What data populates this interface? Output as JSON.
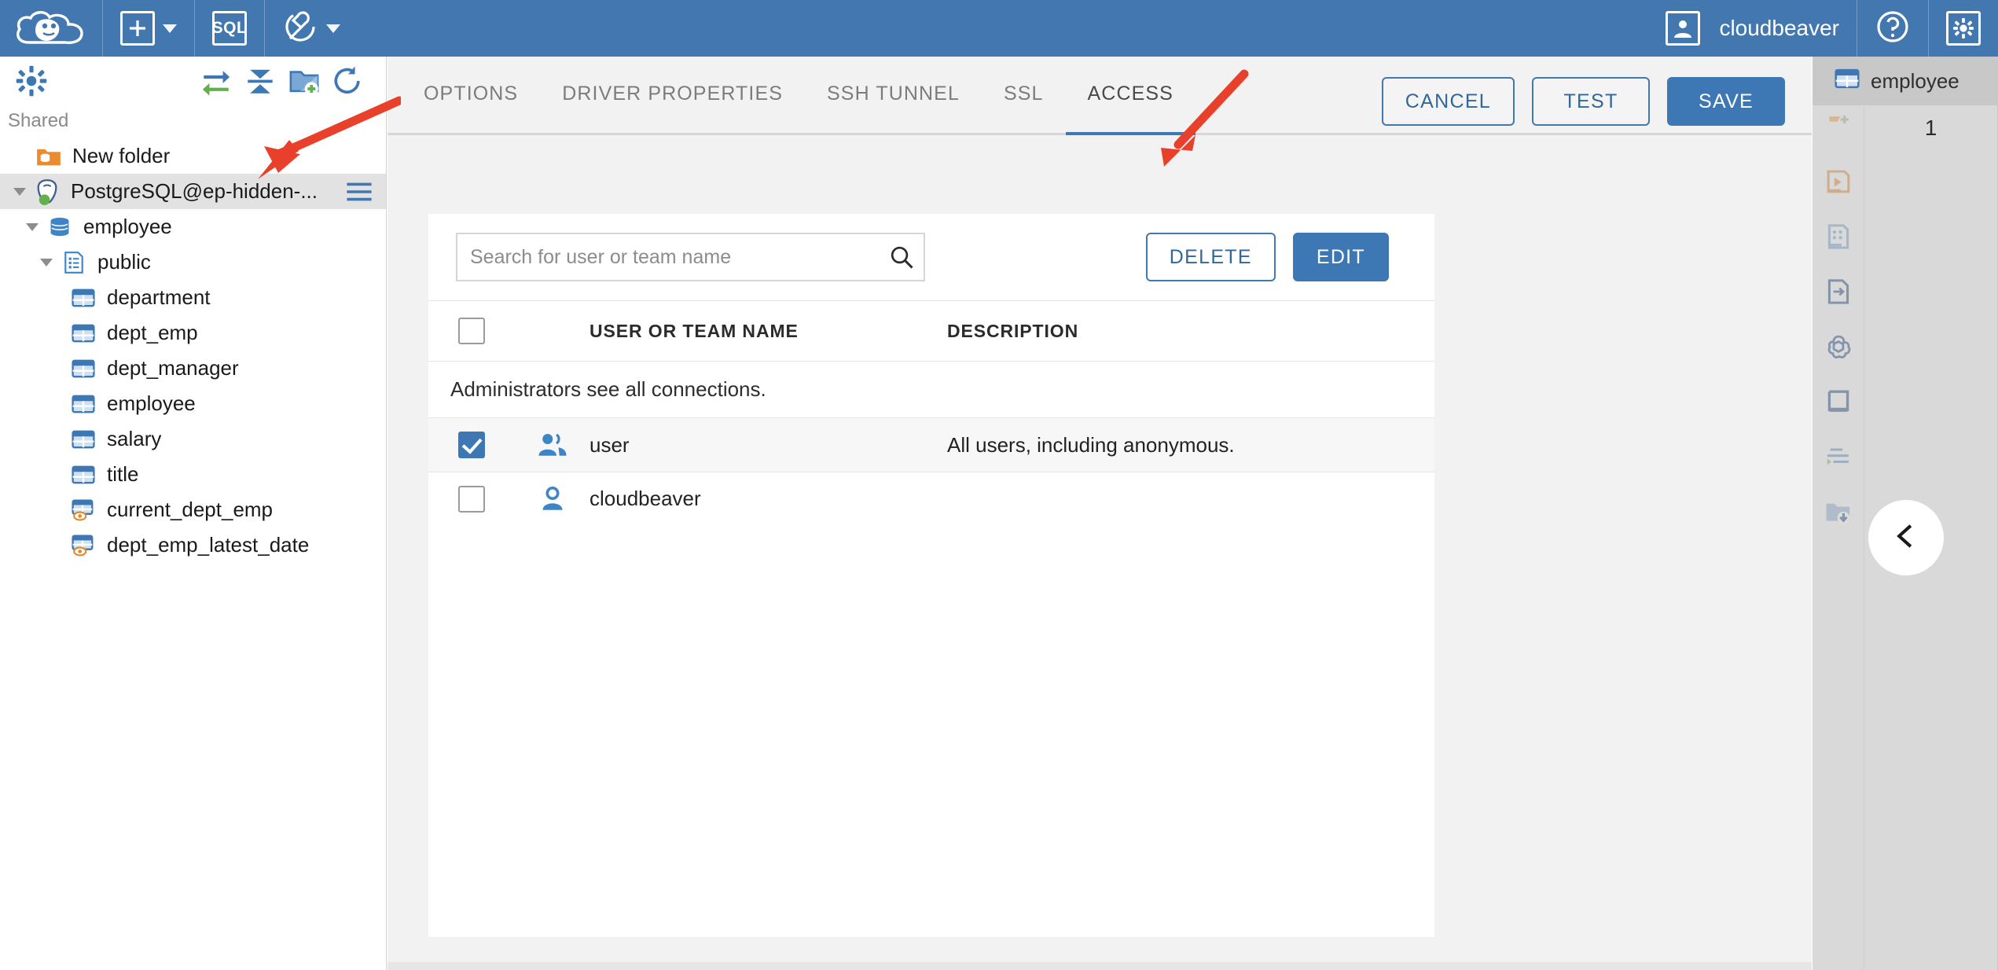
{
  "header": {
    "logo_icon": "cloudbeaver-logo-icon",
    "new_connection_label": "+",
    "new_connection_icon": "plus-box-icon",
    "new_connection_chevron": "chevron-down-icon",
    "sql_label": "SQL",
    "sql_icon": "sql-box-icon",
    "tools_icon": "wrench-circle-icon",
    "tools_chevron": "chevron-down-icon",
    "user_name": "cloudbeaver",
    "user_icon": "user-avatar-icon",
    "help_icon": "question-circle-icon",
    "settings_icon": "gear-box-icon",
    "accent_color": "#4277b0"
  },
  "sidebar": {
    "settings_icon": "gear-icon",
    "toolbar": [
      {
        "name": "sync-connections-icon",
        "title": "Sync"
      },
      {
        "name": "collapse-all-icon",
        "title": "Collapse all"
      },
      {
        "name": "add-folder-icon",
        "title": "Add folder"
      },
      {
        "name": "refresh-icon",
        "title": "Refresh"
      }
    ],
    "shared_label": "Shared",
    "tree": [
      {
        "label": "New folder",
        "icon": "folder-database-icon",
        "indent": 1,
        "expandable": false,
        "selected": false
      },
      {
        "label": "PostgreSQL@ep-hidden-...",
        "icon": "postgresql-connected-icon",
        "indent": 0,
        "expandable": true,
        "selected": true,
        "menu_icon": "hamburger-menu-icon"
      },
      {
        "label": "employee",
        "icon": "database-icon",
        "indent": 1,
        "expandable": true,
        "selected": false
      },
      {
        "label": "public",
        "icon": "schema-icon",
        "indent": 2,
        "expandable": true,
        "selected": false
      },
      {
        "label": "department",
        "icon": "table-icon",
        "indent": 4,
        "expandable": false,
        "selected": false
      },
      {
        "label": "dept_emp",
        "icon": "table-icon",
        "indent": 4,
        "expandable": false,
        "selected": false
      },
      {
        "label": "dept_manager",
        "icon": "table-icon",
        "indent": 4,
        "expandable": false,
        "selected": false
      },
      {
        "label": "employee",
        "icon": "table-icon",
        "indent": 4,
        "expandable": false,
        "selected": false
      },
      {
        "label": "salary",
        "icon": "table-icon",
        "indent": 4,
        "expandable": false,
        "selected": false
      },
      {
        "label": "title",
        "icon": "table-icon",
        "indent": 4,
        "expandable": false,
        "selected": false
      },
      {
        "label": "current_dept_emp",
        "icon": "view-icon",
        "indent": 4,
        "expandable": false,
        "selected": false
      },
      {
        "label": "dept_emp_latest_date",
        "icon": "view-icon",
        "indent": 4,
        "expandable": false,
        "selected": false
      }
    ]
  },
  "main": {
    "tabs": [
      {
        "label": "OPTIONS",
        "active": false
      },
      {
        "label": "DRIVER PROPERTIES",
        "active": false
      },
      {
        "label": "SSH TUNNEL",
        "active": false
      },
      {
        "label": "SSL",
        "active": false
      },
      {
        "label": "ACCESS",
        "active": true
      }
    ],
    "actions": {
      "cancel_label": "CANCEL",
      "test_label": "TEST",
      "save_label": "SAVE"
    },
    "access": {
      "search_placeholder": "Search for user or team name",
      "search_value": "",
      "search_icon": "search-icon",
      "delete_label": "DELETE",
      "edit_label": "EDIT",
      "columns": [
        "",
        "",
        "USER OR TEAM NAME",
        "DESCRIPTION"
      ],
      "note": "Administrators see all connections.",
      "header_checkbox_checked": false,
      "rows": [
        {
          "checked": true,
          "icon": "team-group-icon",
          "name": "user",
          "description": "All users, including anonymous."
        },
        {
          "checked": false,
          "icon": "single-user-icon",
          "name": "cloudbeaver",
          "description": ""
        }
      ]
    }
  },
  "right_panel": {
    "tab_label": "employee",
    "tab_icon": "table-icon",
    "cell_value": "1",
    "collapse_icon": "chevron-left-icon",
    "icons": [
      "flag-add-icon",
      "run-script-icon",
      "grid-data-icon",
      "export-document-icon",
      "openai-icon",
      "sql-panel-icon",
      "log-list-icon",
      "download-folder-icon"
    ]
  },
  "annotations": {
    "arrow_color": "#e8402a",
    "arrow1_target": "postgresql-connection-tree-row",
    "arrow2_target": "tab-access"
  }
}
